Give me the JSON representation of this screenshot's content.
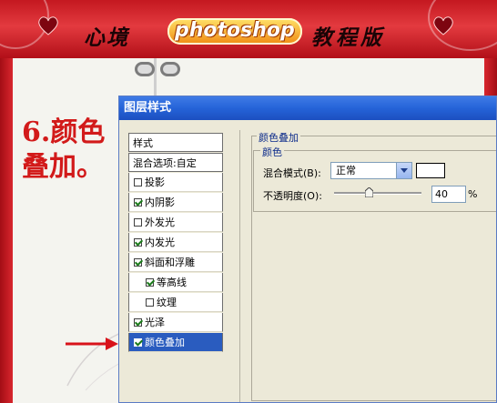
{
  "banner": {
    "title_left": "心境",
    "logo_text": "photoshop",
    "title_right": "教程版"
  },
  "tutorial": {
    "step_line1": "6.颜色",
    "step_line2": "叠加。"
  },
  "dialog": {
    "title": "图层样式",
    "left_panel": {
      "header": "样式",
      "blend_options": "混合选项:自定",
      "items": [
        {
          "label": "投影",
          "checked": false
        },
        {
          "label": "内阴影",
          "checked": true
        },
        {
          "label": "外发光",
          "checked": false
        },
        {
          "label": "内发光",
          "checked": true
        },
        {
          "label": "斜面和浮雕",
          "checked": true
        },
        {
          "label": "等高线",
          "checked": true
        },
        {
          "label": "纹理",
          "checked": false
        },
        {
          "label": "光泽",
          "checked": true
        },
        {
          "label": "颜色叠加",
          "checked": true
        }
      ]
    },
    "section_title": "颜色叠加",
    "group_title": "颜色",
    "blend_mode_label": "混合模式(B):",
    "blend_mode_value": "正常",
    "opacity_label": "不透明度(O):",
    "opacity_value": "40",
    "opacity_unit": "%",
    "opacity_level": 0.4
  },
  "colors": {
    "banner_red": "#d8262d",
    "title_blue": "#2563d8",
    "selection_blue": "#2a5cbf",
    "step_text_red": "#d21a1a",
    "overlay_color": "#ffffff"
  }
}
